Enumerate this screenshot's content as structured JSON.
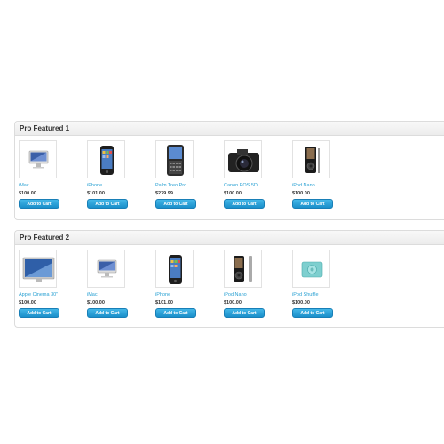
{
  "modules": [
    {
      "title": "Pro Featured 1",
      "products": [
        {
          "name": "iMac",
          "price": "$100.00",
          "button": "Add to Cart",
          "image": "imac-icon"
        },
        {
          "name": "iPhone",
          "price": "$101.00",
          "button": "Add to Cart",
          "image": "iphone-icon"
        },
        {
          "name": "Palm Treo Pro",
          "price": "$279.99",
          "button": "Add to Cart",
          "image": "palm-treo-icon"
        },
        {
          "name": "Canon EOS 5D",
          "price": "$100.00",
          "button": "Add to Cart",
          "image": "camera-icon"
        },
        {
          "name": "iPod Nano",
          "price": "$100.00",
          "button": "Add to Cart",
          "image": "ipod-nano-icon"
        }
      ]
    },
    {
      "title": "Pro Featured 2",
      "products": [
        {
          "name": "Apple Cinema 30\"",
          "price": "$100.00",
          "button": "Add to Cart",
          "image": "cinema-display-icon"
        },
        {
          "name": "iMac",
          "price": "$100.00",
          "button": "Add to Cart",
          "image": "imac-icon"
        },
        {
          "name": "iPhone",
          "price": "$101.00",
          "button": "Add to Cart",
          "image": "iphone-icon"
        },
        {
          "name": "iPod Nano",
          "price": "$100.00",
          "button": "Add to Cart",
          "image": "ipod-nano-icon"
        },
        {
          "name": "iPod Shuffle",
          "price": "$100.00",
          "button": "Add to Cart",
          "image": "ipod-shuffle-icon"
        }
      ]
    }
  ],
  "colors": {
    "link": "#2aa1d3",
    "button": "#1a8fca",
    "border": "#dcdcdc"
  }
}
